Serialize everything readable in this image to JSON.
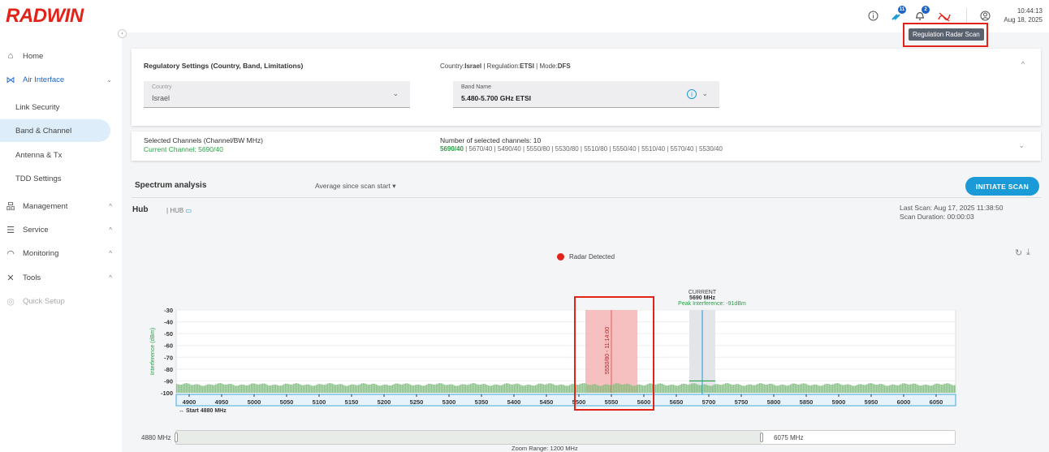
{
  "app": {
    "logo": "RADWIN"
  },
  "topbar": {
    "info_icon": "info-circle-icon",
    "link_badge": "11",
    "alert_badge": "2",
    "time": "10:44:13",
    "date": "Aug 18, 2025",
    "tooltip": "Regulation Radar Scan"
  },
  "sidebar": {
    "collapse_icon": "‹",
    "items": [
      {
        "label": "Home",
        "icon": "home-icon",
        "glyph": "⌂"
      },
      {
        "label": "Air Interface",
        "icon": "antenna-icon",
        "glyph": "⋈"
      },
      {
        "label": "Management",
        "icon": "hierarchy-icon",
        "glyph": "品"
      },
      {
        "label": "Service",
        "icon": "sliders-icon",
        "glyph": "☰"
      },
      {
        "label": "Monitoring",
        "icon": "wifi-icon",
        "glyph": "◠"
      },
      {
        "label": "Tools",
        "icon": "tools-icon",
        "glyph": "✕"
      },
      {
        "label": "Quick Setup",
        "icon": "quick-setup-icon",
        "glyph": "◎"
      }
    ],
    "sub_items": [
      {
        "label": "Link Security"
      },
      {
        "label": "Band & Channel"
      },
      {
        "label": "Antenna & Tx"
      },
      {
        "label": "TDD Settings"
      }
    ]
  },
  "regulatory": {
    "title": "Regulatory Settings (Country, Band, Limitations)",
    "country_prefix": "Country:",
    "country_value": "Israel",
    "regulation_prefix": "| Regulation:",
    "regulation_value": "ETSI",
    "mode_prefix": "| Mode:",
    "mode_value": "DFS",
    "country_field_label": "Country",
    "country_field_value": "Israel",
    "band_field_label": "Band Name",
    "band_field_value": "5.480-5.700 GHz ETSI"
  },
  "channels": {
    "title": "Selected Channels (Channel/BW MHz)",
    "current": "Current Channel: 5690/40",
    "count": "Number of selected channels: 10",
    "first": "5690/40",
    "rest": "| 5670/40 | 5490/40 | 5550/80 | 5530/80 | 5510/80 | 5550/40 | 5510/40 | 5570/40 | 5530/40"
  },
  "spectrum": {
    "title": "Spectrum analysis",
    "mode": "Average since scan start",
    "button": "INITIATE SCAN",
    "hub_title": "Hub",
    "hub_tag": "HUB",
    "last_scan": "Last Scan: Aug 17, 2025 11:38:50",
    "duration": "Scan Duration: 00:00:03",
    "legend": "Radar Detected",
    "current_label": "CURRENT",
    "current_freq": "5690 MHz",
    "peak": "Peak Interference: -91dBm",
    "radar_label": "5550/80 - 11:14:00",
    "start_label": "Start 4880 MHz",
    "zoom_min": "4880 MHz",
    "zoom_max": "6075 MHz",
    "zoom_range": "Zoom Range: 1200 MHz"
  },
  "chart_data": {
    "type": "bar",
    "ylabel": "Interference (dBm)",
    "ylim": [
      -100,
      -30
    ],
    "yticks": [
      "-30",
      "-40",
      "-50",
      "-60",
      "-70",
      "-80",
      "-90",
      "-100"
    ],
    "xlim": [
      4880,
      6080
    ],
    "xticks": [
      "4900",
      "4950",
      "5000",
      "5050",
      "5100",
      "5150",
      "5200",
      "5250",
      "5300",
      "5350",
      "5400",
      "5450",
      "5500",
      "5550",
      "5600",
      "5650",
      "5700",
      "5750",
      "5800",
      "5850",
      "5900",
      "5950",
      "6000",
      "6050"
    ],
    "radar_band": [
      5510,
      5590
    ],
    "current_band": [
      5670,
      5710
    ],
    "current_center": 5690,
    "noise_floor": -93,
    "colors": {
      "bars": "#7ec97e",
      "radar": "#f6b5b5",
      "current": "#e3e5e8",
      "accent": "#1a9bd7",
      "radar_dot": "#e2231a"
    }
  }
}
